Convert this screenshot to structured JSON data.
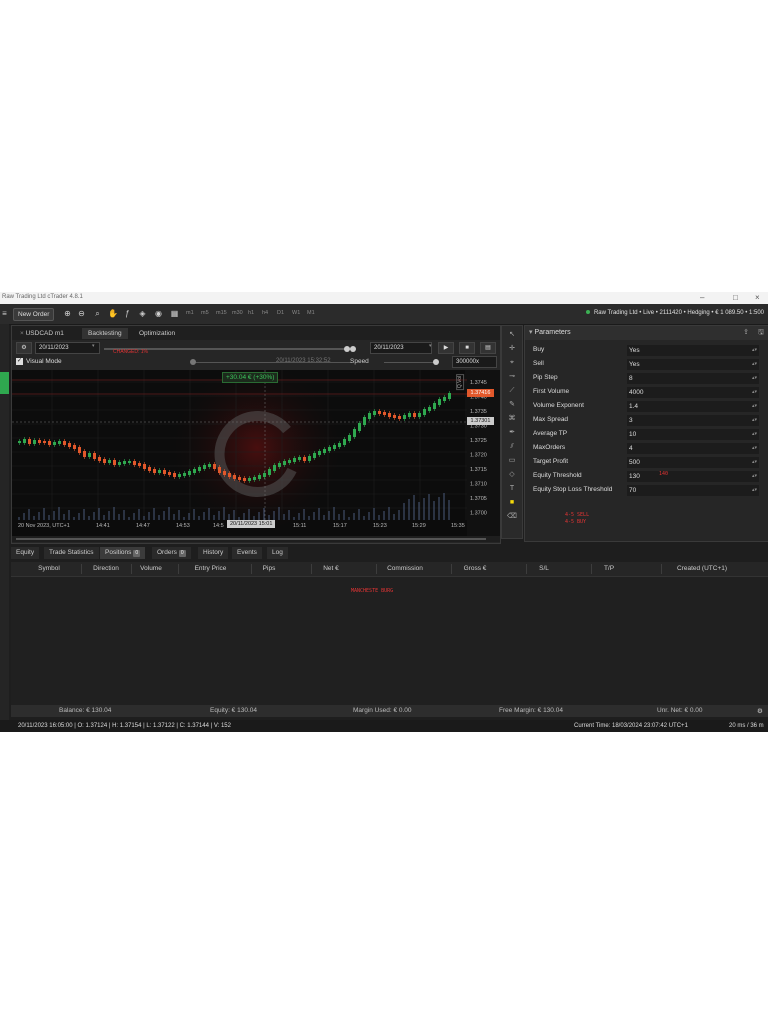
{
  "window": {
    "title": "Raw Trading Ltd cTrader 4.8.1"
  },
  "toolbar": {
    "new_order": "New Order",
    "timeframes": [
      "m1",
      "m5",
      "m15",
      "m30",
      "h1",
      "h4",
      "D1",
      "W1",
      "M1"
    ],
    "account": "Raw Trading Ltd • Live • 2111420 • Hedging • € 1 089.50 • 1:500"
  },
  "chart_tabs": {
    "symbol": "USDCAD",
    "timeframe": "m1",
    "backtesting": "Backtesting",
    "optimization": "Optimization"
  },
  "backtest": {
    "start_date": "20/11/2023",
    "end_date": "20/11/2023",
    "current_time": "20/11/2023 15:32:52",
    "speed_label": "Speed",
    "speed_value": "300000x",
    "visual_mode": "Visual Mode",
    "red_annotation": "CHANGED: 1%"
  },
  "chart": {
    "pnl_label": "+30.04 € (+30%)",
    "time_labels": [
      "20 Nov 2023, UTC+1",
      "14:41",
      "14:47",
      "14:53",
      "14:5",
      "15:11",
      "15:17",
      "15:23",
      "15:29",
      "15:35"
    ],
    "cursor_time": "20/11/2023 15:01",
    "price_labels": [
      "1.3745",
      "1.3740",
      "1.3735",
      "1.3730",
      "1.3725",
      "1.3720",
      "1.3715",
      "1.3710",
      "1.3705",
      "1.3700"
    ],
    "current_price": "1.37416",
    "cursor_price": "1.37301",
    "vol_tag": "Q.Vol"
  },
  "parameters": {
    "title": "Parameters",
    "rows": [
      {
        "label": "Buy",
        "value": "Yes"
      },
      {
        "label": "Sell",
        "value": "Yes"
      },
      {
        "label": "Pip Step",
        "value": "8"
      },
      {
        "label": "First Volume",
        "value": "4000"
      },
      {
        "label": "Volume Exponent",
        "value": "1.4"
      },
      {
        "label": "Max Spread",
        "value": "3"
      },
      {
        "label": "Average TP",
        "value": "10"
      },
      {
        "label": "MaxOrders",
        "value": "4"
      },
      {
        "label": "Target Profit",
        "value": "500"
      },
      {
        "label": "Equity Threshold",
        "value": "130"
      },
      {
        "label": "Equity Stop Loss Threshold",
        "value": "70"
      }
    ],
    "red_note_equity": "140",
    "red_note_1": "4-5  SELL",
    "red_note_2": "4-5  BUY"
  },
  "bottom_tabs": [
    {
      "label": "Equity"
    },
    {
      "label": "Trade Statistics"
    },
    {
      "label": "Positions",
      "count": "0"
    },
    {
      "label": "Orders",
      "count": "0"
    },
    {
      "label": "History"
    },
    {
      "label": "Events"
    },
    {
      "label": "Log"
    }
  ],
  "positions_columns": [
    "Symbol",
    "Direction",
    "Volume",
    "Entry Price",
    "Pips",
    "Net €",
    "Commission",
    "Gross €",
    "S/L",
    "T/P",
    "Created (UTC+1)"
  ],
  "positions_red_note": "MANCHESTE BURG",
  "summary": {
    "balance": "Balance: € 130.04",
    "equity": "Equity: € 130.04",
    "margin_used": "Margin Used: € 0.00",
    "free_margin": "Free Margin: € 130.04",
    "unr_net": "Unr. Net: € 0.00"
  },
  "statusbar": {
    "ohlc": "20/11/2023 16:05:00  |  O: 1.37124  |  H: 1.37154  |  L: 1.37122  |  C: 1.37144  |  V: 152",
    "current_time": "Current Time: 18/03/2024 23:07:42  UTC+1",
    "latency": "20 ms / 36 m"
  },
  "colors": {
    "bull": "#2fa84f",
    "bear": "#e2582b",
    "accent_red": "#e23434"
  }
}
